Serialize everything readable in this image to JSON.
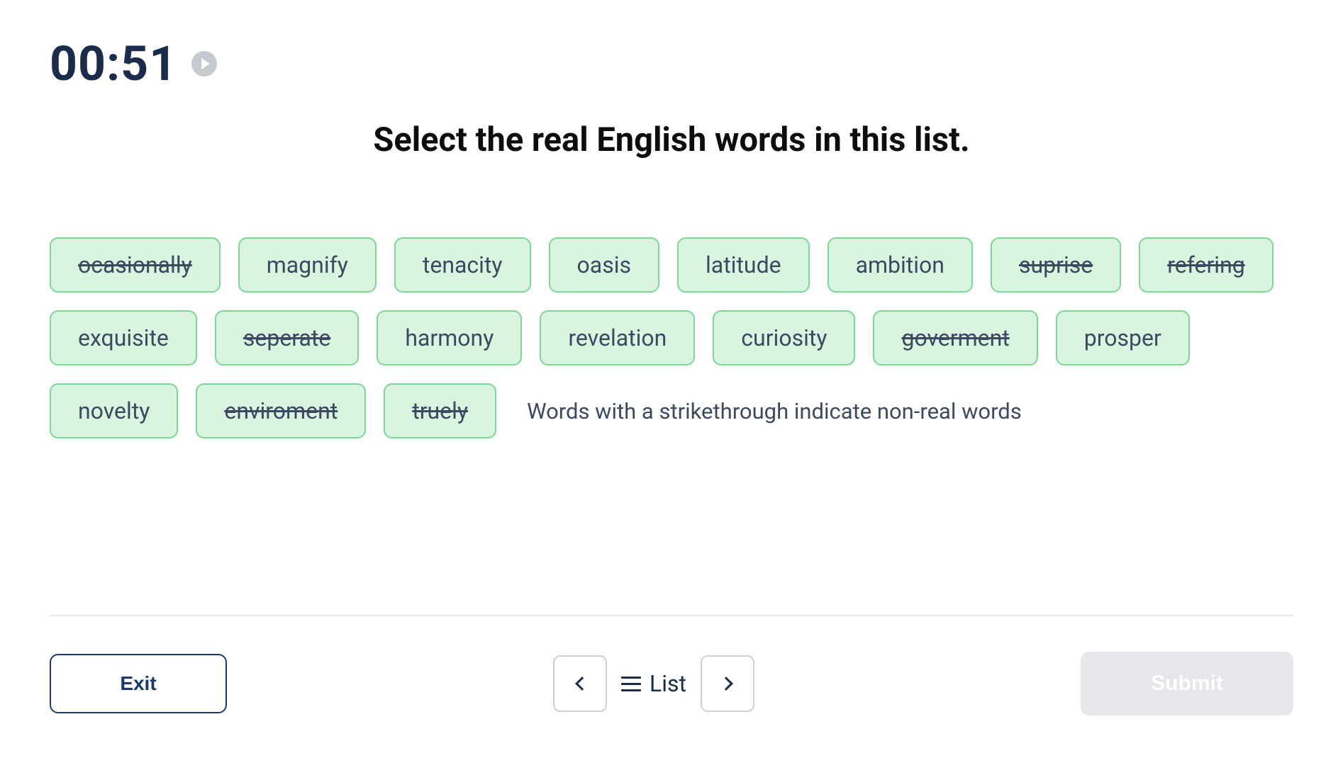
{
  "timer": "00:51",
  "question": "Select the real English words in this list.",
  "hint": "Words with a strikethrough indicate non-real words",
  "words": [
    {
      "text": "ocasionally",
      "strikethrough": true
    },
    {
      "text": "magnify",
      "strikethrough": false
    },
    {
      "text": "tenacity",
      "strikethrough": false
    },
    {
      "text": "oasis",
      "strikethrough": false
    },
    {
      "text": "latitude",
      "strikethrough": false
    },
    {
      "text": "ambition",
      "strikethrough": false
    },
    {
      "text": "suprise",
      "strikethrough": true
    },
    {
      "text": "refering",
      "strikethrough": true
    },
    {
      "text": "exquisite",
      "strikethrough": false
    },
    {
      "text": "seperate",
      "strikethrough": true
    },
    {
      "text": "harmony",
      "strikethrough": false
    },
    {
      "text": "revelation",
      "strikethrough": false
    },
    {
      "text": "curiosity",
      "strikethrough": false
    },
    {
      "text": "goverment",
      "strikethrough": true
    },
    {
      "text": "prosper",
      "strikethrough": false
    },
    {
      "text": "novelty",
      "strikethrough": false
    },
    {
      "text": "enviroment",
      "strikethrough": true
    },
    {
      "text": "truely",
      "strikethrough": true
    }
  ],
  "footer": {
    "exit_label": "Exit",
    "list_label": "List",
    "submit_label": "Submit"
  }
}
